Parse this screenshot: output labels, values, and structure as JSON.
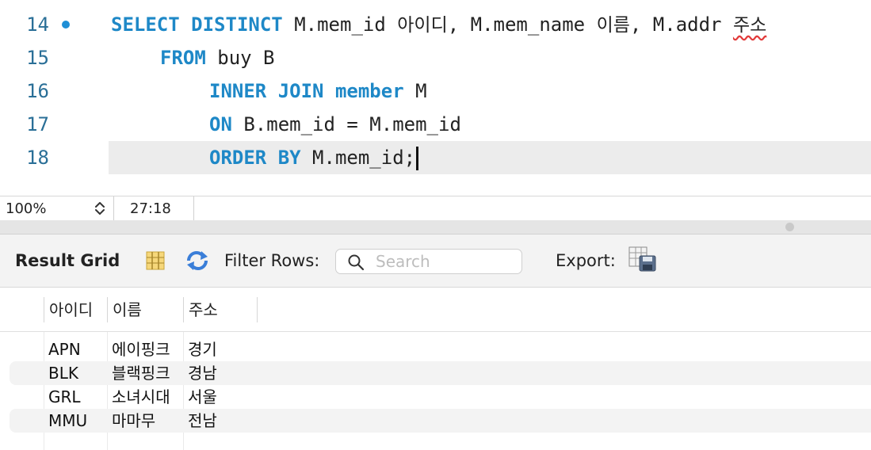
{
  "editor": {
    "lines": [
      {
        "number": "14",
        "marker": true,
        "segments": [
          {
            "t": "SELECT DISTINCT",
            "kw": true
          },
          {
            "t": " M.mem_id "
          },
          {
            "t": "아이디",
            "ko": true
          },
          {
            "t": ", M.mem_name "
          },
          {
            "t": "이름",
            "ko": true
          },
          {
            "t": ", M.addr "
          },
          {
            "t": "주소",
            "ko": true,
            "squiggle": true
          }
        ]
      },
      {
        "number": "15",
        "indent": 2,
        "segments": [
          {
            "t": "FROM",
            "kw": true
          },
          {
            "t": " buy B"
          }
        ]
      },
      {
        "number": "16",
        "indent": 4,
        "segments": [
          {
            "t": "INNER JOIN member",
            "kw": true
          },
          {
            "t": " M"
          }
        ]
      },
      {
        "number": "17",
        "indent": 4,
        "segments": [
          {
            "t": "ON",
            "kw": true
          },
          {
            "t": " B.mem_id = M.mem_id"
          }
        ]
      },
      {
        "number": "18",
        "indent": 4,
        "active": true,
        "segments": [
          {
            "t": "ORDER BY",
            "kw": true
          },
          {
            "t": " M.mem_id;"
          }
        ]
      }
    ]
  },
  "status": {
    "zoom": "100%",
    "cursor": "27:18"
  },
  "result": {
    "title": "Result Grid",
    "filter_label": "Filter Rows:",
    "search_placeholder": "Search",
    "search_value": "",
    "export_label": "Export:",
    "columns": [
      "아이디",
      "이름",
      "주소"
    ],
    "rows": [
      [
        "APN",
        "에이핑크",
        "경기"
      ],
      [
        "BLK",
        "블랙핑크",
        "경남"
      ],
      [
        "GRL",
        "소녀시대",
        "서울"
      ],
      [
        "MMU",
        "마마무",
        "전남"
      ]
    ]
  },
  "icons": {
    "line_marker": "breakpoint-dot-icon",
    "zoom_stepper": "up-down-stepper-icon",
    "grid_view": "grid-view-icon",
    "refresh": "refresh-icon",
    "search": "search-icon",
    "export": "export-icon"
  },
  "colors": {
    "keyword": "#1e88c7",
    "line_number": "#2a6f97",
    "marker": "#1f8fd6",
    "active_line": "#ececec",
    "alt_row": "#f3f3f3"
  }
}
